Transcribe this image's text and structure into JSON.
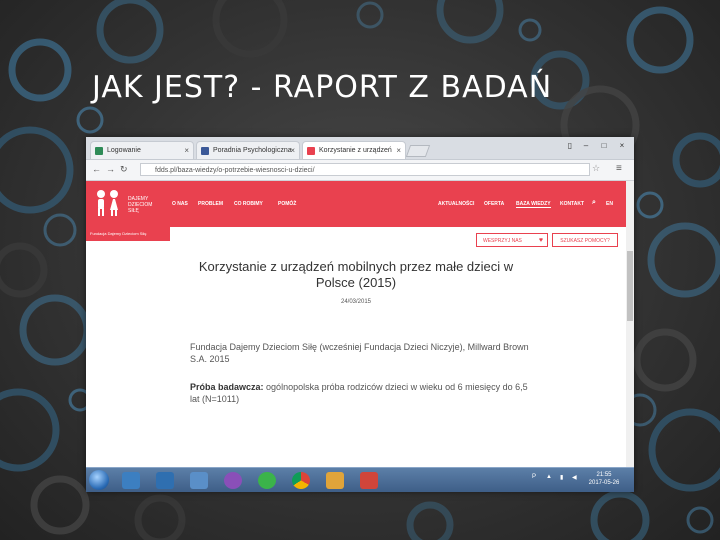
{
  "slide": {
    "title": "JAK JEST? - RAPORT Z BADAŃ"
  },
  "browser": {
    "tabs": [
      {
        "label": "Logowanie"
      },
      {
        "label": "Poradnia Psychologiczna"
      },
      {
        "label": "Korzystanie z urządzeń"
      }
    ],
    "url": "fdds.pl/baza-wiedzy/o-potrzebie-wiesnosci-u-dzieci/"
  },
  "site": {
    "logo_text": "DAJEMY DZIECIOM SIŁĘ",
    "nav_left": [
      "O NAS",
      "PROBLEM",
      "CO ROBIMY",
      "POMÓŻ"
    ],
    "nav_right": [
      "AKTUALNOŚCI",
      "OFERTA",
      "BAZA WIEDZY",
      "KONTAKT"
    ],
    "lang": "EN",
    "strip_text": "Fundacja Dajemy Dzieciom Siłę",
    "btn_support": "WESPRZYJ NAS",
    "btn_help": "SZUKASZ POMOCY?",
    "article": {
      "title": "Korzystanie z urządzeń mobilnych przez małe dzieci w Polsce (2015)",
      "date": "24/03/2015",
      "source": "Fundacja Dajemy Dzieciom Siłę (wcześniej Fundacja Dzieci Niczyje), Millward Brown S.A. 2015",
      "sample_label": "Próba badawcza:",
      "sample_text": "ogólnopolska próba rodziców dzieci w wieku od 6 miesięcy do 6,5 lat (N=1011)"
    }
  },
  "taskbar": {
    "lang": "P",
    "time": "21:55",
    "date": "2017-05-26"
  }
}
